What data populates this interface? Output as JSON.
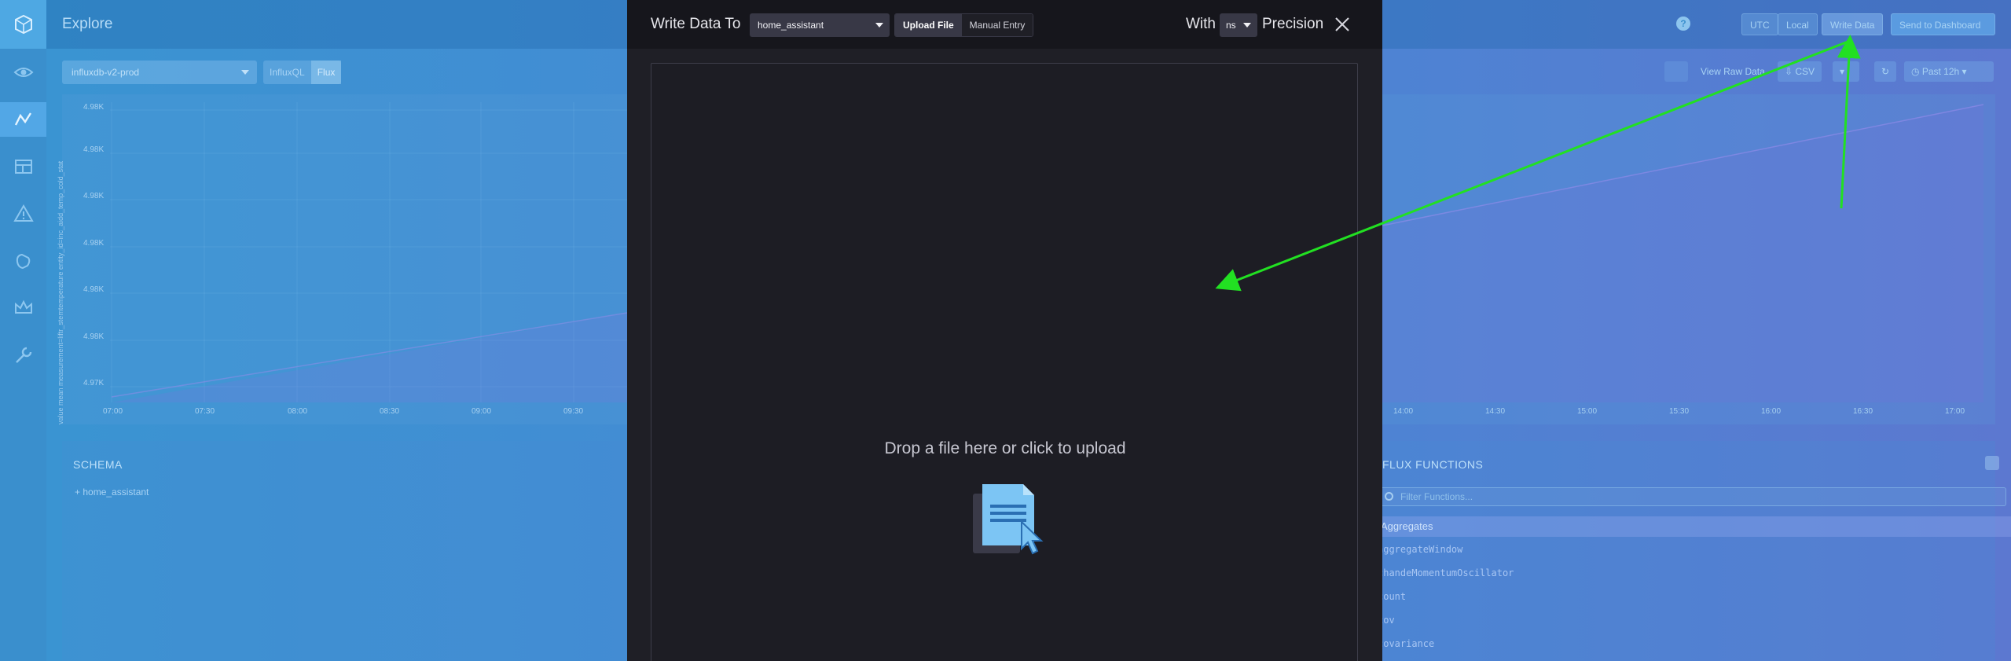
{
  "app": {
    "page_title": "Explore",
    "header": {
      "help_label": "?",
      "utc_label": "UTC",
      "local_label": "Local",
      "write_data_label": "Write Data",
      "send_to_dashboard_label": "Send to Dashboard"
    },
    "query": {
      "bucket": "influxdb-v2-prod",
      "lang_options": [
        "InfluxQL",
        "Flux"
      ],
      "selected_lang": "Flux"
    },
    "chart": {
      "yaxis_label": "value mean measurement=liftr_stemtemperature entity_id=inc_aidd_temp_cold_stat",
      "y_ticks": [
        "4.98K",
        "4.98K",
        "4.98K",
        "4.98K",
        "4.98K",
        "4.98K",
        "4.97K"
      ],
      "x_ticks_left": [
        "07:00",
        "07:30",
        "08:00",
        "08:30",
        "09:00",
        "09:30"
      ],
      "x_ticks_right": [
        "14:00",
        "14:30",
        "15:00",
        "15:30",
        "16:00",
        "16:30",
        "17:00"
      ]
    },
    "tools": {
      "view_raw_data_label": "View Raw Data",
      "csv_label": "CSV",
      "time_range_label": "Past 12h"
    },
    "schema": {
      "title": "SCHEMA",
      "items": [
        "home_assistant"
      ]
    },
    "flux_functions": {
      "title": "FLUX FUNCTIONS",
      "filter_placeholder": "Filter Functions...",
      "category": "Aggregates",
      "functions": [
        "aggregateWindow",
        "chandeMomentumOscillator",
        "count",
        "cov",
        "covariance"
      ]
    }
  },
  "modal": {
    "title": "Write Data To",
    "bucket": "home_assistant",
    "modes": [
      "Upload File",
      "Manual Entry"
    ],
    "active_mode": "Upload File",
    "with_label": "With",
    "precision_value": "ns",
    "precision_label": "Precision",
    "drop_text": "Drop a file here or click to upload"
  },
  "colors": {
    "annotation_arrow": "#22e022",
    "modal_bg": "#1f1f26",
    "file_icon": "#7cc5f4"
  }
}
